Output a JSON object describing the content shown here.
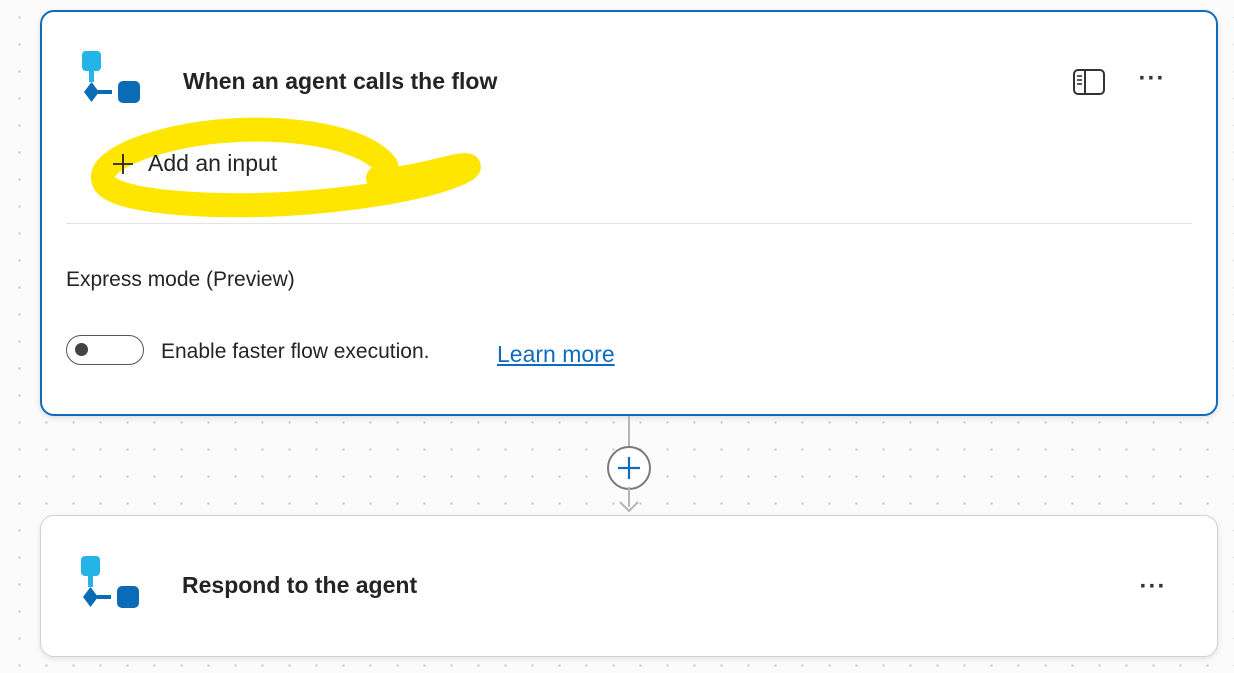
{
  "trigger_card": {
    "title": "When an agent calls the flow",
    "add_input_label": "Add an input",
    "express_mode_label": "Express mode (Preview)",
    "toggle_label": "Enable faster flow execution.",
    "toggle_state": "off",
    "learn_more_label": "Learn more",
    "more_label": "···"
  },
  "respond_card": {
    "title": "Respond to the agent",
    "more_label": "···"
  },
  "icons": {
    "node": "agent-flow-icon",
    "panel": "side-panel-icon",
    "add_step": "plus-circle-icon",
    "add_input": "plus-icon"
  },
  "colors": {
    "accent": "#0f6cbd",
    "link": "#0f6cbd",
    "highlight": "#ffe600",
    "icon_light": "#25b4e8",
    "icon_dark": "#0b6bb5"
  }
}
